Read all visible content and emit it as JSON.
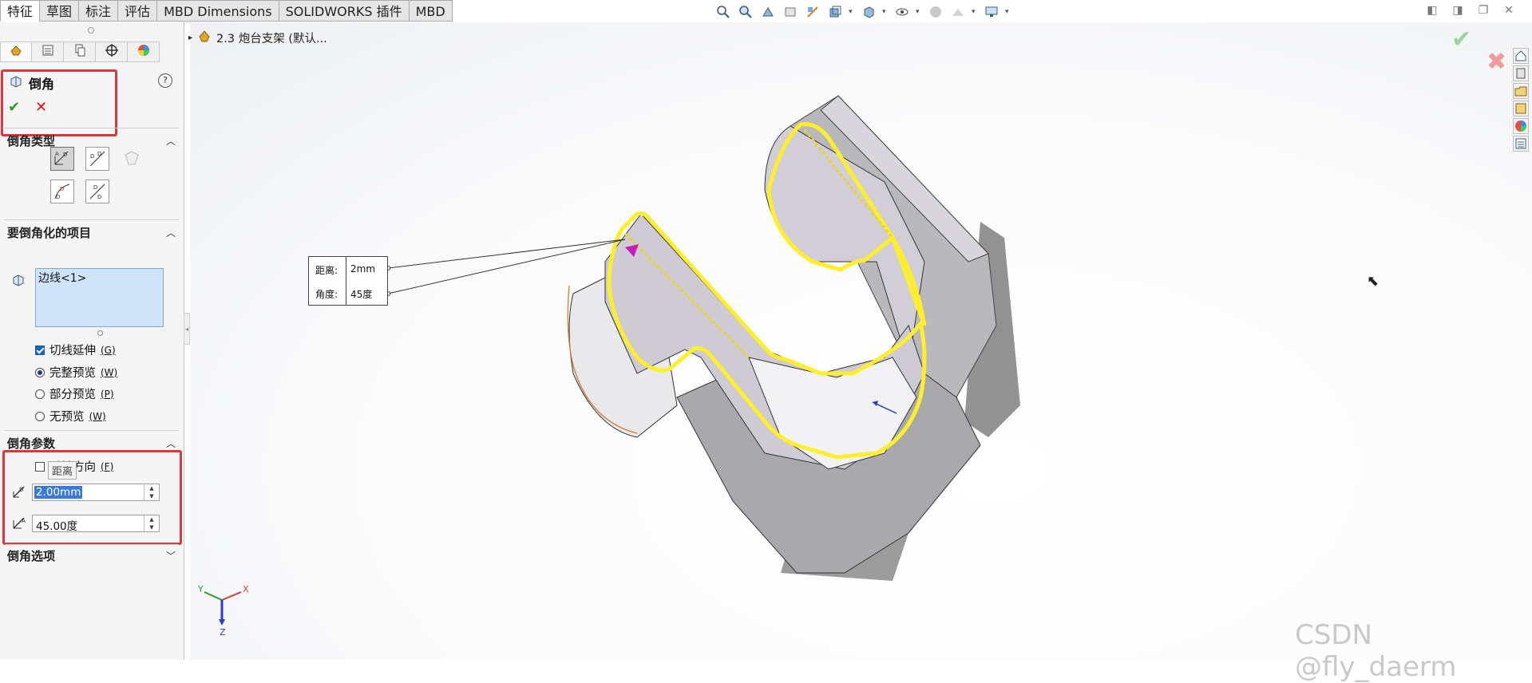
{
  "command_tabs": [
    {
      "label": "特征",
      "active": true
    },
    {
      "label": "草图",
      "active": false
    },
    {
      "label": "标注",
      "active": false
    },
    {
      "label": "评估",
      "active": false
    },
    {
      "label": "MBD Dimensions",
      "active": false
    },
    {
      "label": "SOLIDWORKS 插件",
      "active": false
    },
    {
      "label": "MBD",
      "active": false
    }
  ],
  "heads_up_icons": [
    "zoom-to-fit-icon",
    "zoom-area-icon",
    "previous-view-icon",
    "section-view-icon",
    "dynamic-annotation-icon",
    "view-orientation-icon",
    "display-style-icon",
    "hide-show-icon",
    "edit-appearance-icon",
    "apply-scene-icon",
    "view-settings-icon"
  ],
  "property_manager": {
    "title": "倒角",
    "help": "?",
    "ok": "✔",
    "cancel": "✕",
    "sections": {
      "chamfer_type": {
        "heading": "倒角类型"
      },
      "items": {
        "heading": "要倒角化的项目",
        "value": "边线<1>"
      },
      "params": {
        "heading": "倒角参数"
      },
      "options": {
        "heading": "倒角选项"
      }
    },
    "options": {
      "tangent_propagation": {
        "label": "切线延伸",
        "key": "(G)",
        "checked": true
      },
      "full_preview": {
        "label": "完整预览",
        "key": "(W)",
        "selected": true
      },
      "partial_preview": {
        "label": "部分预览",
        "key": "(P)",
        "selected": false
      },
      "no_preview": {
        "label": "无预览",
        "key": "(W)",
        "selected": false
      }
    },
    "flip_direction": {
      "label": "反转方向",
      "key": "(F)",
      "checked": false
    },
    "tooltip": "距离",
    "distance": {
      "value": "2.00mm"
    },
    "angle": {
      "value": "45.00度"
    }
  },
  "tree_node": {
    "label": "2.3 炮台支架  (默认..."
  },
  "callout": {
    "distance_label": "距离:",
    "distance_value": "2mm",
    "angle_label": "角度:",
    "angle_value": "45度"
  },
  "triad": {
    "x": "X",
    "y": "Y",
    "z": "Z"
  },
  "watermark": "CSDN @fly_daerm",
  "colors": {
    "highlight": "#ffef2a",
    "part_face": "#d5d1d9",
    "part_side": "#9a9a9a",
    "redbox": "#d9383d"
  }
}
